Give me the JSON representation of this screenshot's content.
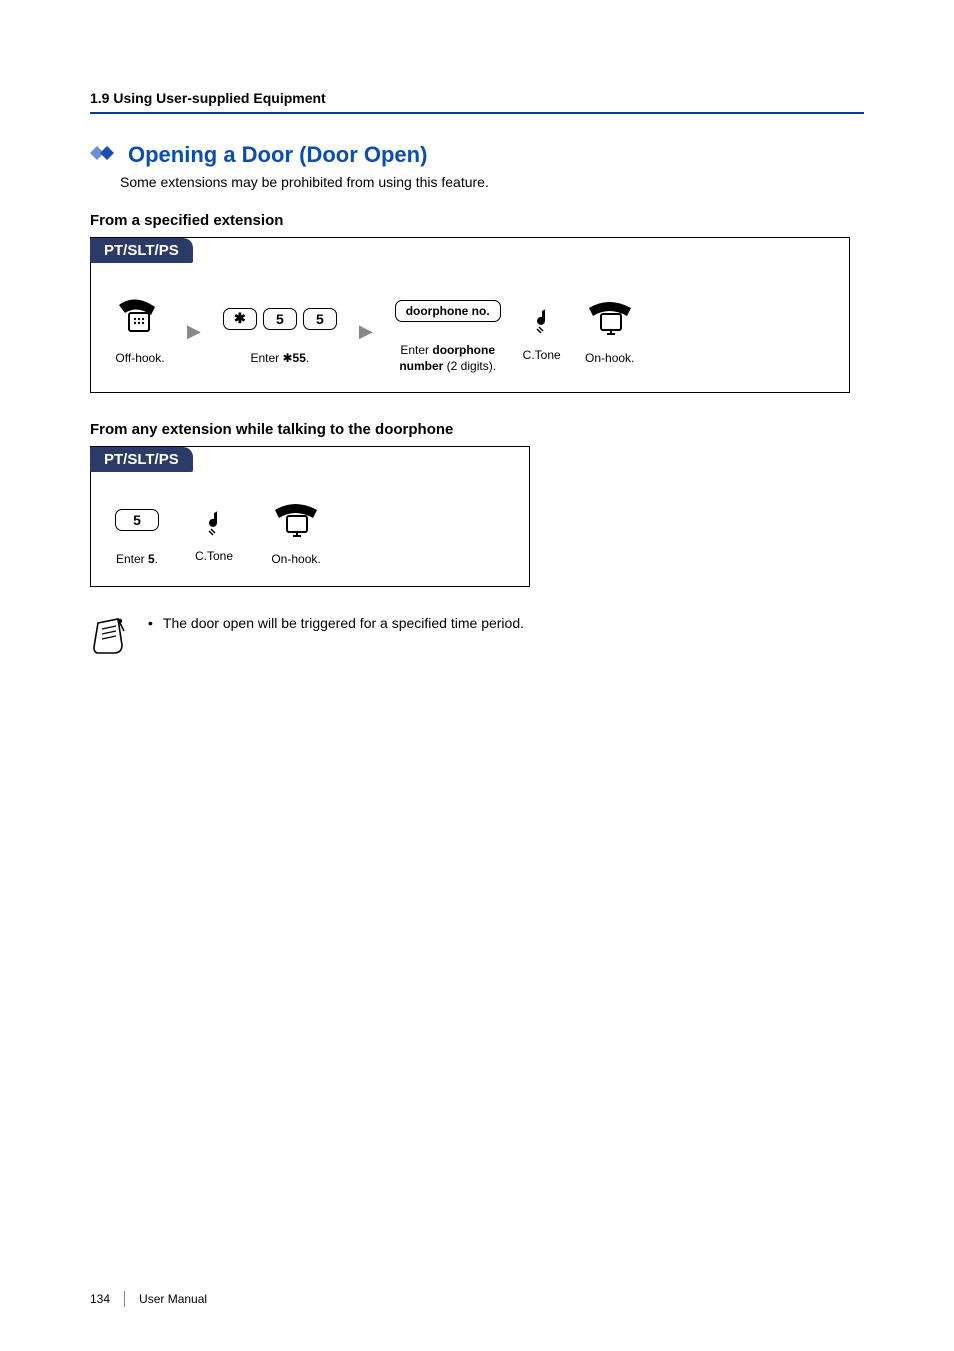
{
  "header": {
    "section": "1.9 Using User-supplied Equipment"
  },
  "title": "Opening a Door (Door Open)",
  "intro": "Some extensions may be prohibited from using this feature.",
  "block1": {
    "heading": "From a specified extension",
    "tab": "PT/SLT/PS",
    "steps": {
      "offhook": "Off-hook.",
      "enter55_pre": "Enter ",
      "enter55_code": "55",
      "enter55_post": ".",
      "doorphone_key": "doorphone no.",
      "doorphone_caption_pre": "Enter ",
      "doorphone_caption_bold1": "doorphone",
      "doorphone_caption_line2_bold": "number",
      "doorphone_caption_line2_rest": " (2 digits).",
      "ctone": "C.Tone",
      "onhook": "On-hook."
    },
    "keys": {
      "star": "✱",
      "five_a": "5",
      "five_b": "5"
    }
  },
  "block2": {
    "heading": "From any extension while talking to the doorphone",
    "tab": "PT/SLT/PS",
    "steps": {
      "enter5_pre": "Enter ",
      "enter5_bold": "5",
      "enter5_post": ".",
      "ctone": "C.Tone",
      "onhook": "On-hook."
    },
    "keys": {
      "five": "5"
    }
  },
  "note": {
    "bullet": "•",
    "text": "The door open will be triggered for a specified time period."
  },
  "footer": {
    "page": "134",
    "label": "User Manual"
  }
}
